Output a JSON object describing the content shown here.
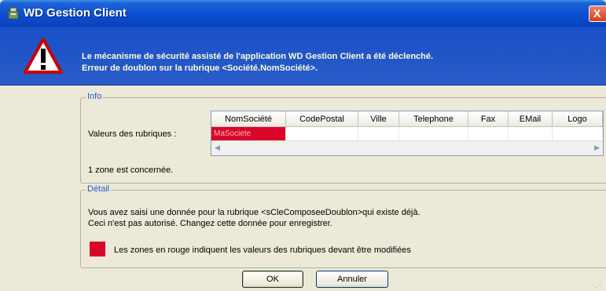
{
  "window": {
    "title": "WD Gestion Client",
    "close_glyph": "X"
  },
  "header": {
    "line1": "Le mécanisme de sécurité assisté de l'application WD Gestion Client a été déclenché.",
    "line2": "Erreur de doublon sur la rubrique <Société.NomSociété>."
  },
  "info": {
    "legend": "Info",
    "label": "Valeurs des rubriques :",
    "columns": [
      "NomSociété",
      "CodePostal",
      "Ville",
      "Telephone",
      "Fax",
      "EMail",
      "Logo"
    ],
    "row": [
      "MaSociete",
      "",
      "",
      "",
      "",
      "",
      ""
    ],
    "zone_text": "1 zone est concernée."
  },
  "detail": {
    "legend": "Détail",
    "line1": "Vous avez saisi une donnée pour la rubrique <sCleComposeeDoublon>qui existe déjà.",
    "line2": "Ceci n'est pas autorisé. Changez cette donnée pour enregistrer.",
    "legend_text": "Les zones en rouge indiquent les valeurs des rubriques devant être modifiées"
  },
  "buttons": {
    "ok": "OK",
    "cancel": "Annuler"
  },
  "icons": [
    "app-icon",
    "warning-icon",
    "close-icon",
    "scroll-left-icon",
    "scroll-right-icon"
  ],
  "colors": {
    "title_bar": "#0c4fd0",
    "header_bg": "#1f55c8",
    "header_text": "#fefcd8",
    "error_red": "#d9062a",
    "legend_blue": "#215dc6"
  }
}
